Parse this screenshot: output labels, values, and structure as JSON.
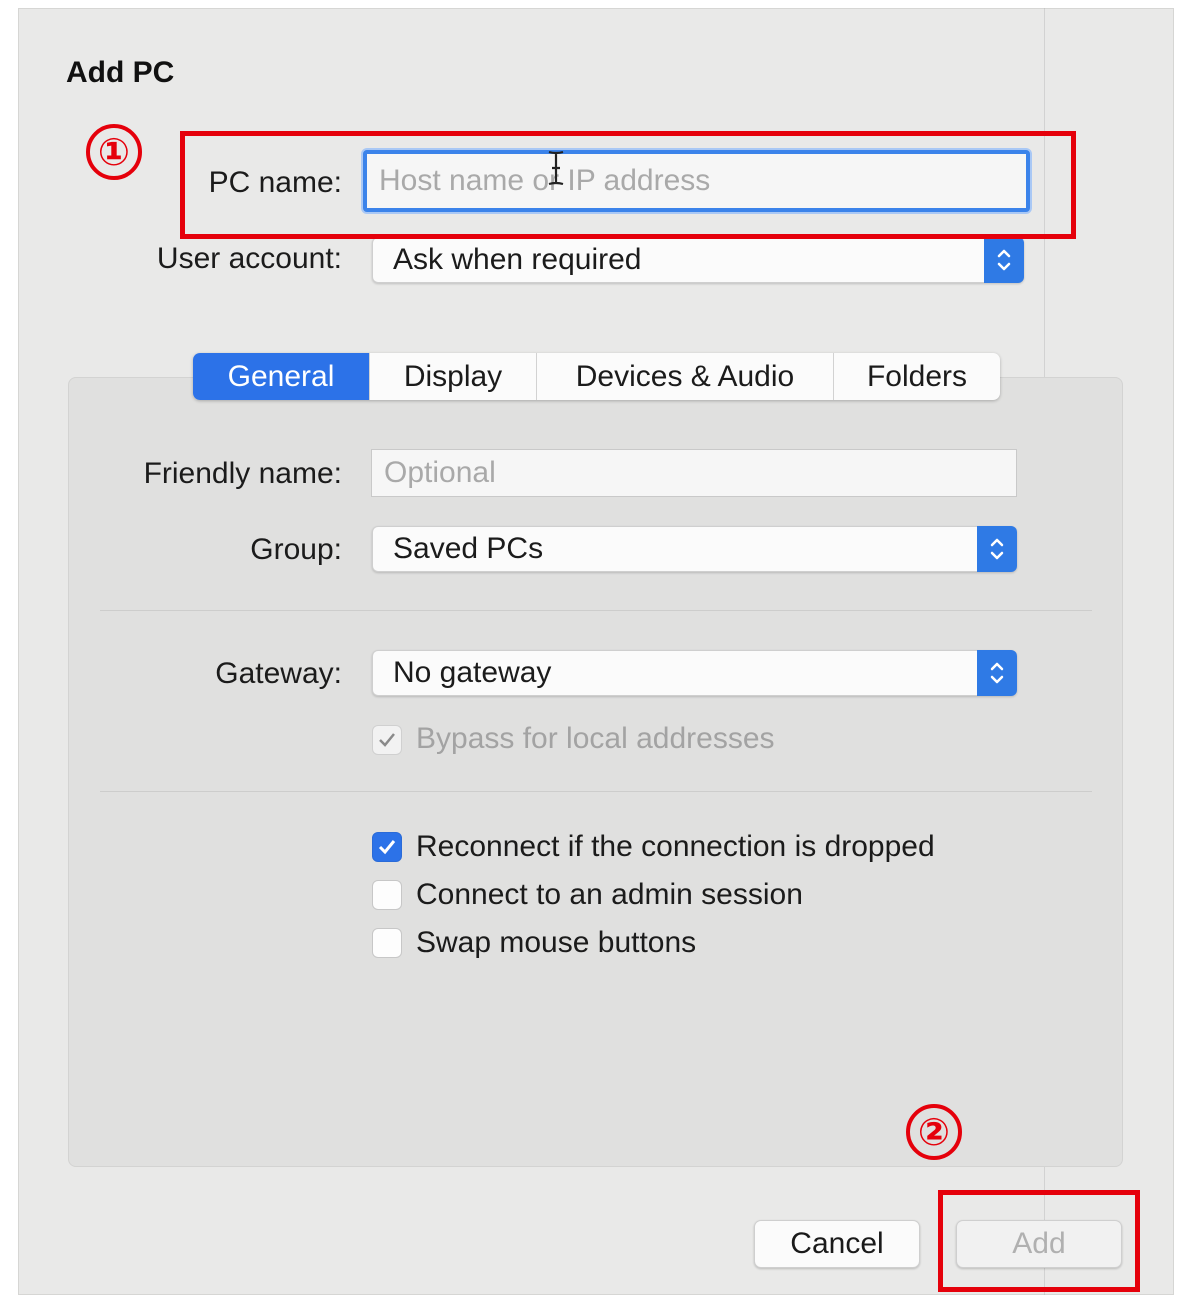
{
  "dialog": {
    "title": "Add PC"
  },
  "fields": {
    "pc_name": {
      "label": "PC name:",
      "placeholder": "Host name or IP address",
      "value": ""
    },
    "user_account": {
      "label": "User account:",
      "value": "Ask when required"
    }
  },
  "tabs": [
    {
      "label": "General",
      "active": true
    },
    {
      "label": "Display",
      "active": false
    },
    {
      "label": "Devices & Audio",
      "active": false
    },
    {
      "label": "Folders",
      "active": false
    }
  ],
  "general": {
    "friendly_name": {
      "label": "Friendly name:",
      "placeholder": "Optional"
    },
    "group": {
      "label": "Group:",
      "value": "Saved PCs"
    },
    "gateway": {
      "label": "Gateway:",
      "value": "No gateway"
    },
    "bypass": {
      "label": "Bypass for local addresses",
      "checked": true,
      "enabled": false
    },
    "options": [
      {
        "label": "Reconnect if the connection is dropped",
        "checked": true
      },
      {
        "label": "Connect to an admin session",
        "checked": false
      },
      {
        "label": "Swap mouse buttons",
        "checked": false
      }
    ]
  },
  "buttons": {
    "cancel": "Cancel",
    "add": "Add"
  },
  "annotations": {
    "marker_1": "①",
    "marker_2": "②"
  },
  "colors": {
    "accent": "#2c72e8",
    "annotation_red": "#e5000b"
  },
  "icons": {
    "stepper": "chevron-up-down-icon",
    "check": "checkmark-icon",
    "cursor": "text-cursor-icon"
  }
}
